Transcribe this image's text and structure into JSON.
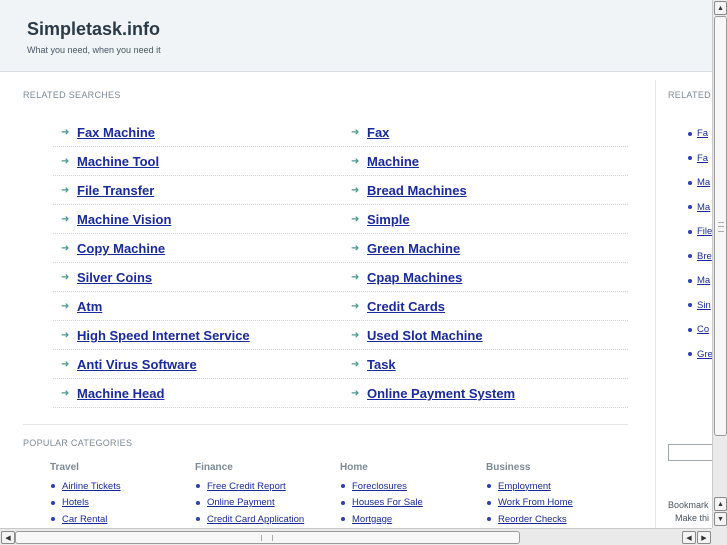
{
  "header": {
    "title": "Simpletask.info",
    "tagline": "What you need, when you need it"
  },
  "related_searches": {
    "title": "RELATED SEARCHES",
    "left": [
      "Fax Machine",
      "Machine Tool",
      "File Transfer",
      "Machine Vision",
      "Copy Machine",
      "Silver Coins",
      "Atm",
      "High Speed Internet Service",
      "Anti Virus Software",
      "Machine Head"
    ],
    "right": [
      "Fax",
      "Machine",
      "Bread Machines",
      "Simple",
      "Green Machine",
      "Cpap Machines",
      "Credit Cards",
      "Used Slot Machine",
      "Task",
      "Online Payment System"
    ]
  },
  "popular_categories": {
    "title": "POPULAR CATEGORIES",
    "columns": [
      {
        "heading": "Travel",
        "items": [
          "Airline Tickets",
          "Hotels",
          "Car Rental"
        ]
      },
      {
        "heading": "Finance",
        "items": [
          "Free Credit Report",
          "Online Payment",
          "Credit Card Application"
        ]
      },
      {
        "heading": "Home",
        "items": [
          "Foreclosures",
          "Houses For Sale",
          "Mortgage"
        ]
      },
      {
        "heading": "Business",
        "items": [
          "Employment",
          "Work From Home",
          "Reorder Checks"
        ]
      }
    ]
  },
  "right_panel": {
    "title": "RELATED",
    "items": [
      "Fa",
      "Fa",
      "Ma",
      "Ma",
      "File",
      "Bre",
      "Ma",
      "Sin",
      "Co",
      "Gre"
    ],
    "bookmark_text": "Bookmark",
    "make_this_text": "Make thi"
  },
  "icons": {
    "arrow": "arrow-right-icon",
    "bullet": "bullet-dot-icon",
    "scroll_up": "chevron-up-icon",
    "scroll_down": "chevron-down-icon",
    "scroll_left": "chevron-left-icon",
    "scroll_right": "chevron-right-icon"
  },
  "colors": {
    "link": "#1a2a9b",
    "header_bg": "#f0f4f7",
    "arrow": "#4a9a8f"
  }
}
